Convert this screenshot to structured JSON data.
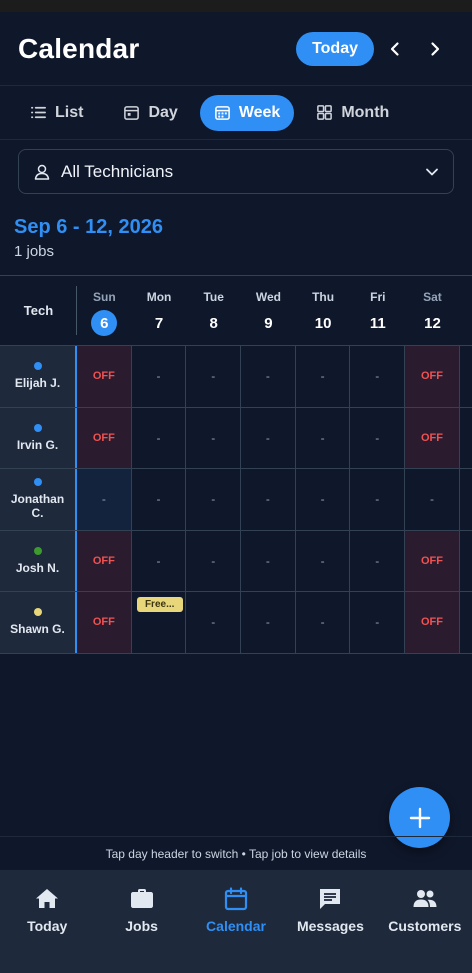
{
  "header": {
    "title": "Calendar",
    "today_label": "Today"
  },
  "views": [
    {
      "label": "List",
      "icon": "list-icon",
      "active": false
    },
    {
      "label": "Day",
      "icon": "day-icon",
      "active": false
    },
    {
      "label": "Week",
      "icon": "calendar-icon",
      "active": true
    },
    {
      "label": "Month",
      "icon": "grid-icon",
      "active": false
    }
  ],
  "filter": {
    "label": "All Technicians"
  },
  "range": {
    "title": "Sep 6 - 12, 2026",
    "job_count": "1 jobs"
  },
  "grid": {
    "tech_header": "Tech",
    "days": [
      {
        "name": "Sun",
        "num": "6",
        "today": true
      },
      {
        "name": "Mon",
        "num": "7"
      },
      {
        "name": "Tue",
        "num": "8"
      },
      {
        "name": "Wed",
        "num": "9"
      },
      {
        "name": "Thu",
        "num": "10"
      },
      {
        "name": "Fri",
        "num": "11"
      },
      {
        "name": "Sat",
        "num": "12"
      }
    ],
    "rows": [
      {
        "name": "Elijah J.",
        "dot": "#2f8ff5",
        "cells": [
          "OFF",
          "-",
          "-",
          "-",
          "-",
          "-",
          "OFF"
        ]
      },
      {
        "name": "Irvin G.",
        "dot": "#2f8ff5",
        "cells": [
          "OFF",
          "-",
          "-",
          "-",
          "-",
          "-",
          "OFF"
        ]
      },
      {
        "name": "Jonathan C.",
        "dot": "#2f8ff5",
        "cells": [
          "-",
          "-",
          "-",
          "-",
          "-",
          "-",
          "-"
        ]
      },
      {
        "name": "Josh N.",
        "dot": "#3c9a2e",
        "cells": [
          "OFF",
          "-",
          "-",
          "-",
          "-",
          "-",
          "OFF"
        ]
      },
      {
        "name": "Shawn G.",
        "dot": "#e8d67a",
        "cells": [
          "OFF",
          "job",
          "-",
          "-",
          "-",
          "-",
          "OFF"
        ],
        "job_label": "Free..."
      }
    ]
  },
  "hint": "Tap day header to switch • Tap job to view details",
  "tabs": [
    {
      "label": "Today",
      "icon": "home-icon"
    },
    {
      "label": "Jobs",
      "icon": "briefcase-icon"
    },
    {
      "label": "Calendar",
      "icon": "calendar-icon",
      "active": true
    },
    {
      "label": "Messages",
      "icon": "message-icon"
    },
    {
      "label": "Customers",
      "icon": "people-icon"
    }
  ],
  "colors": {
    "accent": "#2f8ff5",
    "background": "#0f172a",
    "off": "#f05252"
  }
}
